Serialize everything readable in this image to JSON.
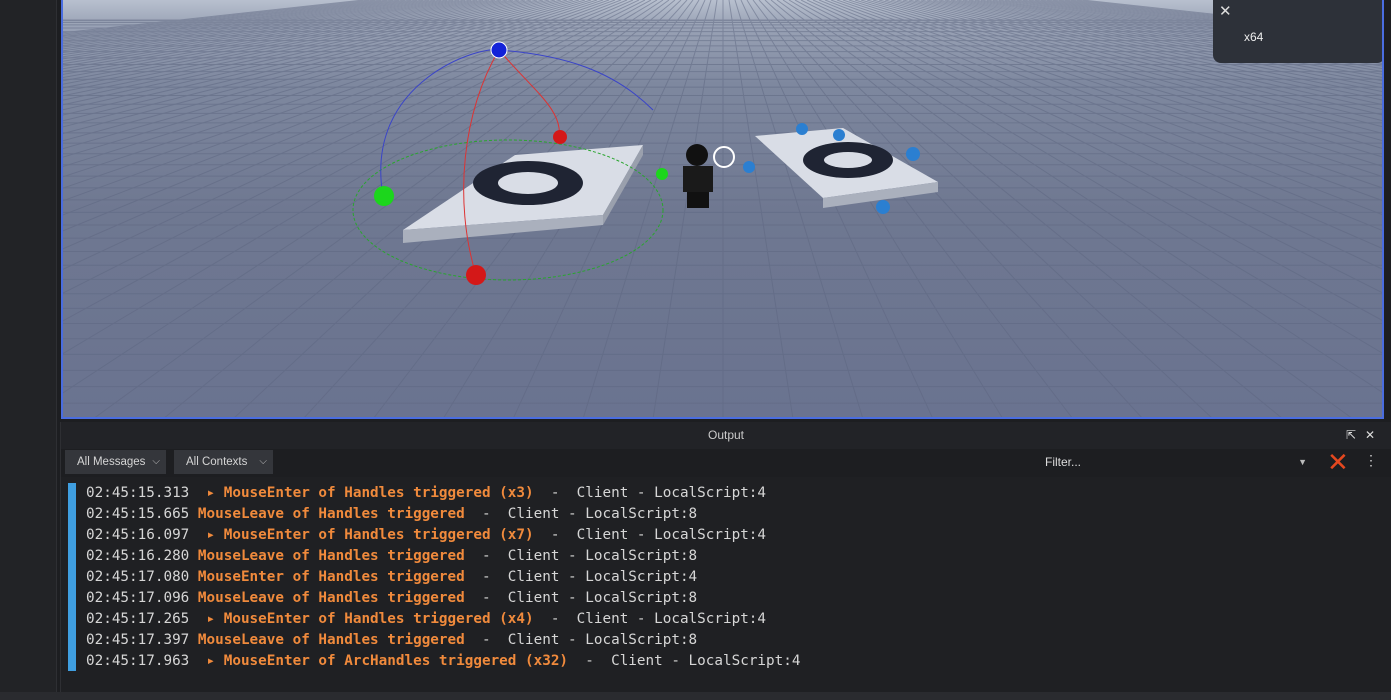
{
  "toast": {
    "close": "✕",
    "text": "x64"
  },
  "output": {
    "title": "Output",
    "undock_icon": "⇱",
    "close_icon": "✕",
    "message_filter": "All Messages",
    "context_filter": "All Contexts",
    "filter_placeholder": "Filter...",
    "clear_icon": "✕",
    "more_icon": "⋮",
    "logs": [
      {
        "time": "02:45:15.313",
        "expand": true,
        "message": "MouseEnter of Handles triggered (x3)",
        "source": "Client - LocalScript:4"
      },
      {
        "time": "02:45:15.665",
        "expand": false,
        "message": "MouseLeave of Handles triggered",
        "source": "Client - LocalScript:8"
      },
      {
        "time": "02:45:16.097",
        "expand": true,
        "message": "MouseEnter of Handles triggered (x7)",
        "source": "Client - LocalScript:4"
      },
      {
        "time": "02:45:16.280",
        "expand": false,
        "message": "MouseLeave of Handles triggered",
        "source": "Client - LocalScript:8"
      },
      {
        "time": "02:45:17.080",
        "expand": false,
        "message": "MouseEnter of Handles triggered",
        "source": "Client - LocalScript:4"
      },
      {
        "time": "02:45:17.096",
        "expand": false,
        "message": "MouseLeave of Handles triggered",
        "source": "Client - LocalScript:8"
      },
      {
        "time": "02:45:17.265",
        "expand": true,
        "message": "MouseEnter of Handles triggered (x4)",
        "source": "Client - LocalScript:4"
      },
      {
        "time": "02:45:17.397",
        "expand": false,
        "message": "MouseLeave of Handles triggered",
        "source": "Client - LocalScript:8"
      },
      {
        "time": "02:45:17.963",
        "expand": true,
        "message": "MouseEnter of ArcHandles triggered (x32)",
        "source": "Client - LocalScript:4"
      }
    ]
  }
}
